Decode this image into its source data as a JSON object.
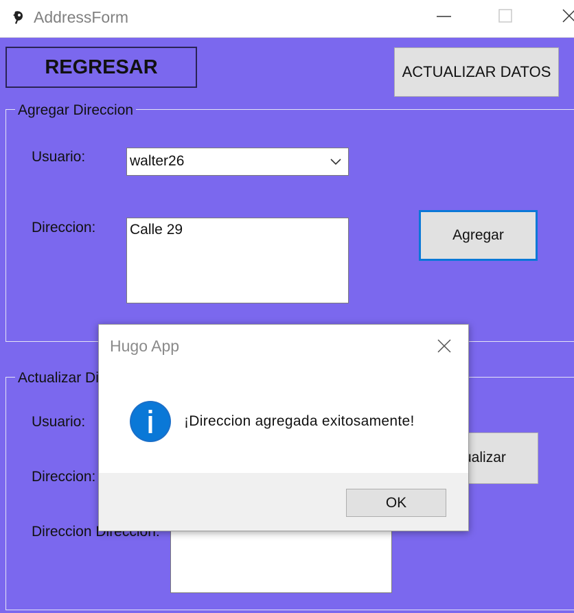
{
  "window": {
    "title": "AddressForm",
    "icons": {
      "app": "app-icon",
      "minimize": "minimize-icon",
      "maximize": "maximize-icon",
      "close": "close-icon"
    }
  },
  "colors": {
    "background": "#7b68ee",
    "dialog_footer": "#f0f0f0",
    "focus_border": "#0a78d7",
    "button": "#e1e1e1"
  },
  "toolbar": {
    "back_label": "REGRESAR",
    "update_data_label": "ACTUALIZAR DATOS"
  },
  "add_group": {
    "legend": "Agregar Direccion",
    "user_label": "Usuario:",
    "user_value": "walter26",
    "address_label": "Direccion:",
    "address_value": "Calle 29",
    "add_button": "Agregar"
  },
  "update_group": {
    "legend": "Actualizar Di",
    "user_label": "Usuario:",
    "address_label": "Direccion:",
    "new_address_label": "Direccion Direccion:",
    "update_button": "ualizar"
  },
  "dialog": {
    "title": "Hugo App",
    "message": "¡Direccion agregada exitosamente!",
    "ok_label": "OK",
    "icon": "info-icon"
  }
}
